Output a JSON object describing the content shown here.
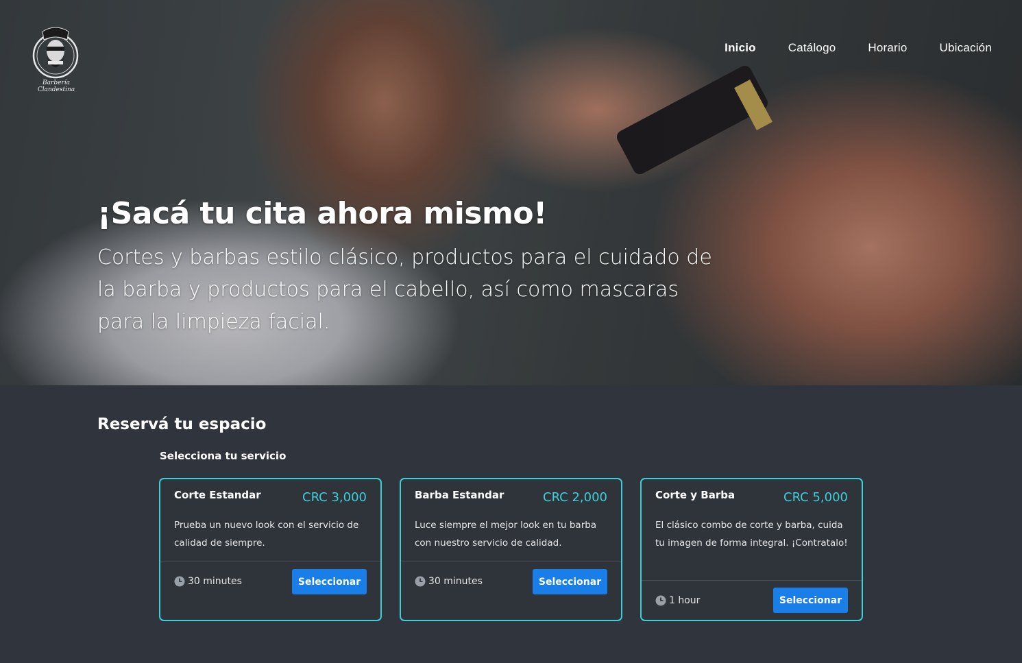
{
  "brand": {
    "logo_text": "Barbería Clandestina"
  },
  "nav": {
    "items": [
      {
        "label": "Inicio",
        "active": true
      },
      {
        "label": "Catálogo",
        "active": false
      },
      {
        "label": "Horario",
        "active": false
      },
      {
        "label": "Ubicación",
        "active": false
      }
    ]
  },
  "hero": {
    "title": "¡Sacá tu cita ahora mismo!",
    "subtitle": "Cortes y barbas estilo clásico, productos para el cuidado de la barba y productos para el cabello, así como mascaras para la limpieza facial."
  },
  "booking": {
    "heading": "Reservá tu espacio",
    "service_prompt": "Selecciona tu servicio",
    "services": [
      {
        "name": "Corte Estandar",
        "price": "CRC 3,000",
        "description": "Prueba un nuevo look con el servicio de calidad de siempre.",
        "duration": "30 minutes",
        "button": "Seleccionar"
      },
      {
        "name": "Barba Estandar",
        "price": "CRC 2,000",
        "description": "Luce siempre el mejor look en tu barba con nuestro servicio de calidad.",
        "duration": "30 minutes",
        "button": "Seleccionar"
      },
      {
        "name": "Corte y Barba",
        "price": "CRC 5,000",
        "description": "El clásico combo de corte y barba, cuida tu imagen de forma integral. ¡Contratalo!",
        "duration": "1 hour",
        "button": "Seleccionar"
      }
    ]
  },
  "colors": {
    "accent": "#3ecfd6",
    "button": "#1a7ee8",
    "background": "#30353d"
  },
  "icons": {
    "duration": "clock-icon"
  }
}
